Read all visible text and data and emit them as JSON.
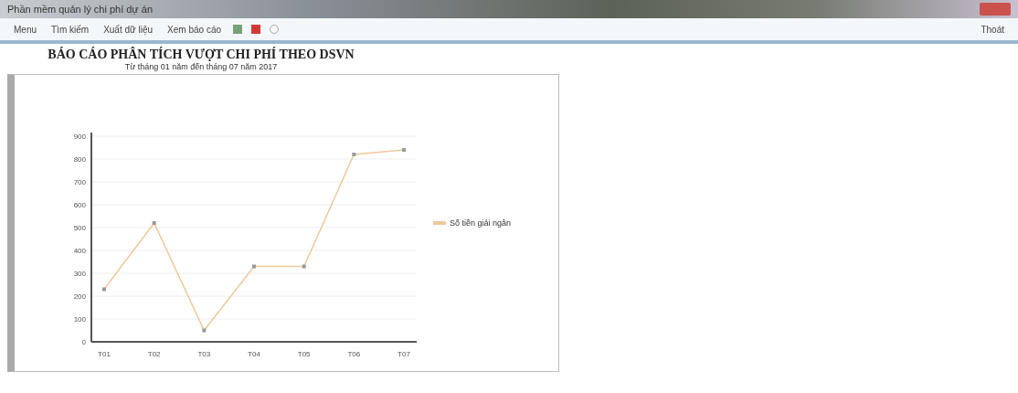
{
  "window": {
    "title": "Phần mềm quản lý chi phí dự án"
  },
  "toolbar": {
    "items": [
      {
        "label": "Menu"
      },
      {
        "label": "Tìm kiếm"
      },
      {
        "label": "Xuất dữ liệu"
      },
      {
        "label": "Xem báo cáo"
      }
    ],
    "right_label": "Thoát"
  },
  "report": {
    "title": "BÁO CÁO PHÂN TÍCH VƯỢT CHI PHÍ THEO DSVN",
    "subtitle": "Từ tháng 01 năm đến tháng 07 năm 2017"
  },
  "chart": {
    "chart_data": {
      "type": "line",
      "categories": [
        "T01",
        "T02",
        "T03",
        "T04",
        "T05",
        "T06",
        "T07"
      ],
      "grid": true,
      "series": [
        {
          "name": "Số tiền giải ngân",
          "color": "#f0c89a",
          "marker": true,
          "values": [
            230,
            520,
            50,
            330,
            330,
            820,
            840
          ]
        }
      ],
      "ylim": [
        0,
        900
      ],
      "yticks": [
        0,
        100,
        200,
        300,
        400,
        500,
        600,
        700,
        800,
        900
      ]
    }
  }
}
